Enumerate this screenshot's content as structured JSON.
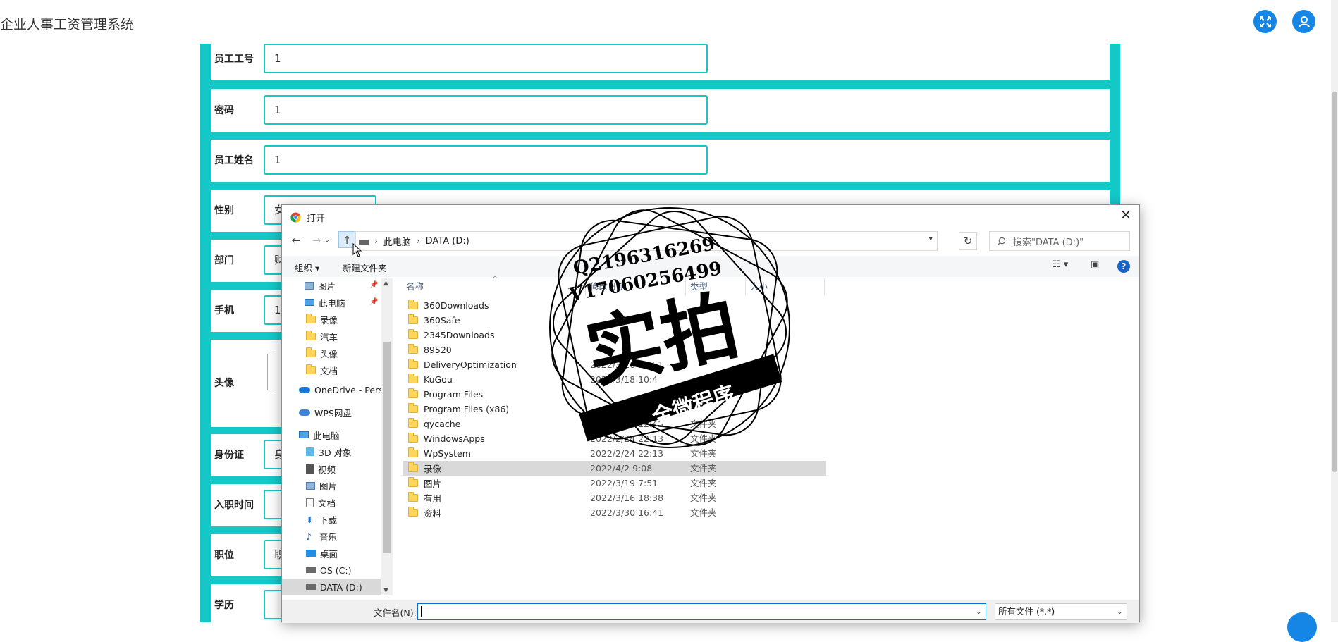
{
  "app": {
    "title": "企业人事工资管理系统",
    "buttons": {
      "fullscreen_icon": "expand-icon",
      "user_icon": "user-icon"
    },
    "accent_color": "#14c8c8",
    "brand_blue": "#1586e6"
  },
  "form": {
    "rows": [
      {
        "label": "员工工号",
        "value": "1"
      },
      {
        "label": "密码",
        "value": "1"
      },
      {
        "label": "员工姓名",
        "value": "1"
      },
      {
        "label": "性别",
        "value": "女"
      },
      {
        "label": "部门",
        "value": "财"
      },
      {
        "label": "手机",
        "value": "1"
      },
      {
        "label": "头像",
        "value": ""
      },
      {
        "label": "身份证",
        "value": "身"
      },
      {
        "label": "入职时间",
        "value": ""
      },
      {
        "label": "职位",
        "value": "职"
      },
      {
        "label": "学历",
        "value": ""
      }
    ]
  },
  "dialog": {
    "title": "打开",
    "address": {
      "crumbs": [
        "此电脑",
        "DATA (D:)"
      ]
    },
    "search_placeholder": "搜索\"DATA (D:)\"",
    "toolbar": {
      "organize": "组织",
      "new_folder": "新建文件夹"
    },
    "nav_items": [
      {
        "label": "图片",
        "icon": "pictures-icon",
        "pinned": true
      },
      {
        "label": "此电脑",
        "icon": "computer-icon",
        "pinned": true
      },
      {
        "label": "录像",
        "icon": "folder-icon"
      },
      {
        "label": "汽车",
        "icon": "folder-icon"
      },
      {
        "label": "头像",
        "icon": "folder-icon"
      },
      {
        "label": "文档",
        "icon": "folder-icon"
      },
      {
        "label": "OneDrive - Perso",
        "icon": "onedrive-icon"
      },
      {
        "label": "WPS网盘",
        "icon": "wps-cloud-icon"
      },
      {
        "label": "此电脑",
        "icon": "computer-icon"
      },
      {
        "label": "3D 对象",
        "icon": "3d-objects-icon"
      },
      {
        "label": "视频",
        "icon": "videos-icon"
      },
      {
        "label": "图片",
        "icon": "pictures-icon"
      },
      {
        "label": "文档",
        "icon": "documents-icon"
      },
      {
        "label": "下载",
        "icon": "downloads-icon"
      },
      {
        "label": "音乐",
        "icon": "music-icon"
      },
      {
        "label": "桌面",
        "icon": "desktop-icon"
      },
      {
        "label": "OS (C:)",
        "icon": "drive-icon"
      },
      {
        "label": "DATA (D:)",
        "icon": "drive-icon",
        "active": true
      }
    ],
    "columns": {
      "name": "名称",
      "date": "修改日期",
      "type": "类型",
      "size": "大小"
    },
    "files": [
      {
        "name": "360Downloads",
        "date": "",
        "type": ""
      },
      {
        "name": "360Safe",
        "date": "",
        "type": ""
      },
      {
        "name": "2345Downloads",
        "date": "",
        "type": ""
      },
      {
        "name": "89520",
        "date": "",
        "type": ""
      },
      {
        "name": "DeliveryOptimization",
        "date": "2022/3/16 21:51",
        "type": ""
      },
      {
        "name": "KuGou",
        "date": "2022/3/18 10:4",
        "type": ""
      },
      {
        "name": "Program Files",
        "date": "",
        "type": ""
      },
      {
        "name": "Program Files (x86)",
        "date": "",
        "type": ""
      },
      {
        "name": "qycache",
        "date": "2022/3/30 12:45",
        "type": "文件夹"
      },
      {
        "name": "WindowsApps",
        "date": "2022/2/24 22:13",
        "type": "文件夹"
      },
      {
        "name": "WpSystem",
        "date": "2022/2/24 22:13",
        "type": "文件夹"
      },
      {
        "name": "录像",
        "date": "2022/4/2 9:08",
        "type": "文件夹",
        "selected": true
      },
      {
        "name": "图片",
        "date": "2022/3/19 7:51",
        "type": "文件夹"
      },
      {
        "name": "有用",
        "date": "2022/3/16 18:38",
        "type": "文件夹"
      },
      {
        "name": "资料",
        "date": "2022/3/30 16:41",
        "type": "文件夹"
      }
    ],
    "filename_label": "文件名(N):",
    "filename_value": "",
    "filetype": "所有文件 (*.*)"
  },
  "watermark": {
    "contact_q": "Q2196316269",
    "contact_v": "V17060256499",
    "main": "实拍",
    "banner": "全微程序"
  }
}
